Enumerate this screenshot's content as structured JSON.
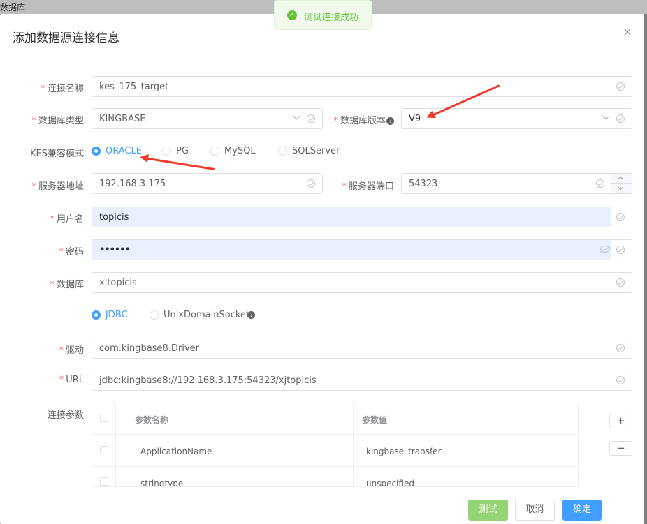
{
  "window": {
    "tab_title": "数据库"
  },
  "toast": {
    "message": "测试连接成功"
  },
  "dialog": {
    "title": "添加数据源连接信息",
    "close": "×",
    "fields": {
      "conn_name": {
        "label": "连接名称",
        "value": "kes_175_target"
      },
      "db_type": {
        "label": "数据库类型",
        "value": "KINGBASE"
      },
      "db_version": {
        "label": "数据库版本",
        "value": "V9"
      },
      "compat_mode": {
        "label": "KES兼容模式",
        "options": [
          "ORACLE",
          "PG",
          "MySQL",
          "SQLServer"
        ],
        "selected": "ORACLE"
      },
      "server_addr": {
        "label": "服务器地址",
        "value": "192.168.3.175"
      },
      "server_port": {
        "label": "服务器端口",
        "value": "54323"
      },
      "username": {
        "label": "用户名",
        "value": "topicis"
      },
      "password": {
        "label": "密码",
        "value": "••••••"
      },
      "database": {
        "label": "数据库",
        "value": "xjtopicis"
      },
      "conn_method": {
        "options": [
          "JDBC",
          "UnixDomainSocket"
        ],
        "selected": "JDBC"
      },
      "driver": {
        "label": "驱动",
        "value": "com.kingbase8.Driver"
      },
      "url": {
        "label": "URL",
        "value": "jdbc:kingbase8://192.168.3.175:54323/xjtopicis"
      }
    },
    "params": {
      "label": "连接参数",
      "headers": [
        "参数名称",
        "参数值"
      ],
      "rows": [
        {
          "name": "ApplicationName",
          "value": "kingbase_transfer"
        },
        {
          "name": "stringtype",
          "value": "unspecified"
        }
      ],
      "add": "+",
      "remove": "−"
    },
    "buttons": {
      "test": "测试",
      "cancel": "取消",
      "confirm": "确定"
    }
  },
  "colors": {
    "primary": "#409eff",
    "success": "#67c23a",
    "required": "#f56c6c",
    "annotation": "#f23a2b"
  }
}
